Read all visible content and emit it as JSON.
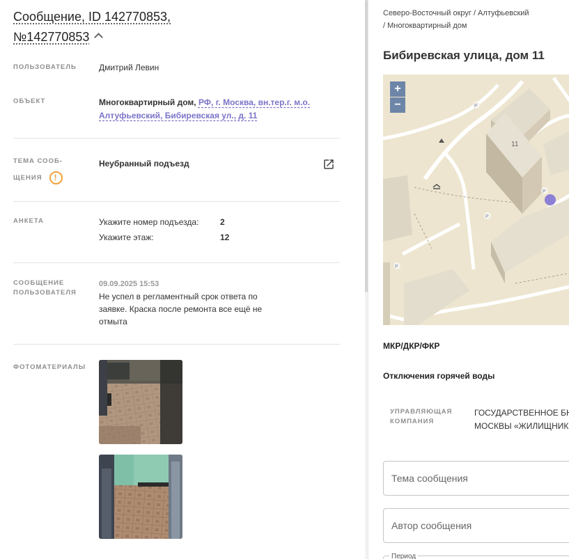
{
  "message": {
    "title_line1": "Сообщение, ID 142770853,",
    "title_line2": "№142770853",
    "user_label": "ПОЛЬЗОВАТЕЛЬ",
    "user_name": "Дмитрий Левин",
    "object_label": "ОБЪЕКТ",
    "object_type": "Многоквартирный дом,",
    "object_address": "РФ, г. Москва, вн.тер.г. м.о. Алтуфьевский, Бибиревская ул., д. 11",
    "topic_label_line1": "ТЕМА СООБ-",
    "topic_label_line2": "ЩЕНИЯ",
    "topic_value": "Неубранный подъезд",
    "survey_label": "АНКЕТА",
    "survey": [
      {
        "question": "Укажите номер подъезда:",
        "answer": "2"
      },
      {
        "question": "Укажите этаж:",
        "answer": "12"
      }
    ],
    "user_message_label_line1": "СООБЩЕНИЕ",
    "user_message_label_line2": "ПОЛЬЗОВАТЕЛЯ",
    "user_message_date": "09.09.2025 15:53",
    "user_message_text": "Не успел в регламентный срок ответа по заявке. Краска после ремонта все ещё не отмыта",
    "photos_label": "ФОТОМАТЕРИАЛЫ"
  },
  "object_panel": {
    "breadcrumb_line1": "Северо-Восточный округ / Алтуфьевский",
    "breadcrumb_line2": "/ Многоквартирный дом",
    "address_title": "Бибиревская улица, дом 11",
    "map": {
      "zoom_in": "+",
      "zoom_out": "−",
      "building_number": "11",
      "parking_label": "P"
    },
    "section_mkr": "МКР/ДКР/ФКР",
    "section_hot_water": "Отключения горячей воды",
    "mc_label_line1": "УПРАВЛЯЮЩАЯ",
    "mc_label_line2": "КОМПАНИЯ",
    "mc_value_line1": "ГОСУДАРСТВЕННОЕ БЮ",
    "mc_value_line2": "МОСКВЫ «ЖИЛИЩНИК",
    "topic_placeholder": "Тема сообщения",
    "author_placeholder": "Автор сообщения",
    "period_label": "Период"
  },
  "colors": {
    "accent_link": "#7b74c8",
    "warning": "#f2a23c",
    "map_background": "#ede5cf",
    "map_marker": "#8b7fd6"
  }
}
